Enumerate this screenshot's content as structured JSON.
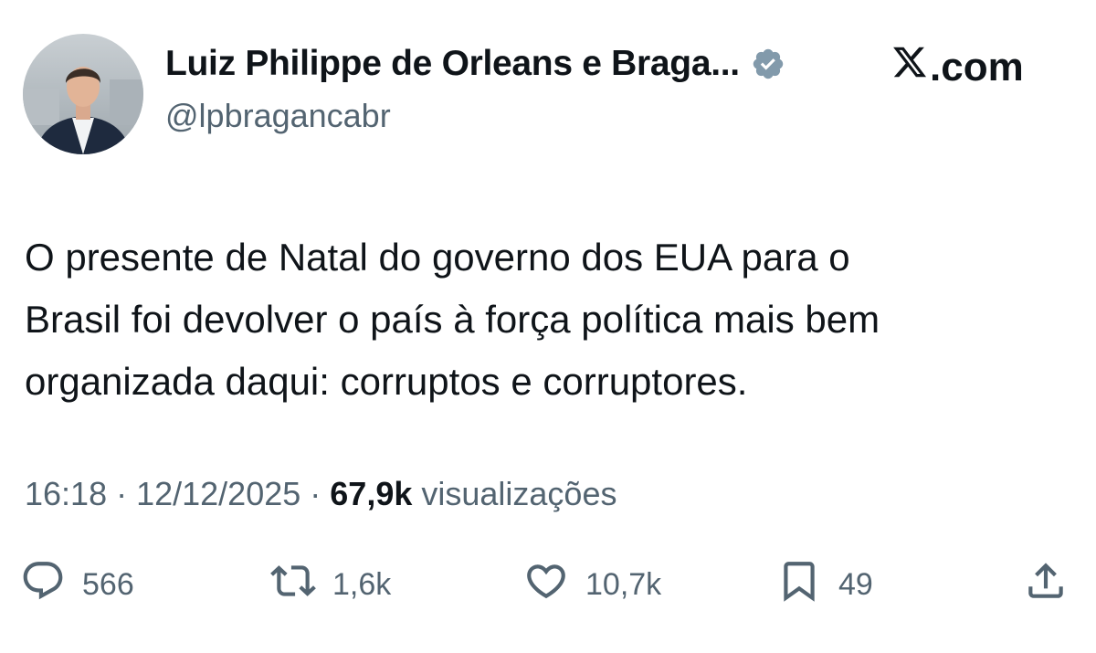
{
  "author": {
    "display_name": "Luiz Philippe de Orleans e Braga...",
    "handle": "@lpbragancabr",
    "verified_icon": "verified-badge-icon",
    "verified_color": "#829aab"
  },
  "brand": {
    "logo_icon": "x-logo-icon",
    "label": ".com"
  },
  "tweet": {
    "lines": [
      "O presente de Natal do governo dos EUA para o",
      "Brasil foi devolver o país à força política mais bem",
      "organizada daqui: corruptos e corruptores."
    ]
  },
  "meta": {
    "time": "16:18",
    "separator": " · ",
    "date": "12/12/2025",
    "views_count": "67,9k",
    "views_label": " visualizações"
  },
  "actions": {
    "reply": {
      "icon": "reply-icon",
      "count": "566"
    },
    "retweet": {
      "icon": "retweet-icon",
      "count": "1,6k"
    },
    "like": {
      "icon": "heart-icon",
      "count": "10,7k"
    },
    "bookmark": {
      "icon": "bookmark-icon",
      "count": "49"
    },
    "share": {
      "icon": "share-icon"
    }
  },
  "colors": {
    "text_primary": "#0f1419",
    "text_secondary": "#536471"
  }
}
